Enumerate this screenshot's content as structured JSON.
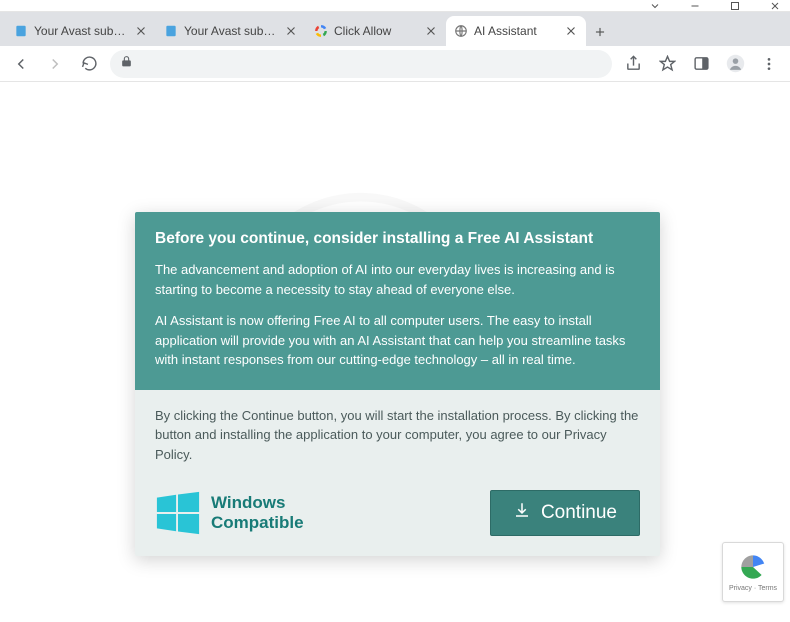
{
  "window": {
    "controls": {
      "min": "—",
      "max": "▢",
      "close": "✕"
    }
  },
  "tabs": [
    {
      "title": "Your Avast subscription",
      "favicon": "doc-blue"
    },
    {
      "title": "Your Avast subscription",
      "favicon": "doc-blue"
    },
    {
      "title": "Click Allow",
      "favicon": "recaptcha"
    },
    {
      "title": "AI Assistant",
      "favicon": "globe",
      "active": true
    }
  ],
  "toolbar": {
    "back": "back-icon",
    "forward": "forward-icon",
    "reload": "reload-icon",
    "lock": "lock-icon",
    "share": "share-icon",
    "star": "star-icon",
    "ext": "extension-icon",
    "profile": "profile-icon",
    "menu": "menu-icon",
    "address": ""
  },
  "modal": {
    "heading": "Before you continue, consider installing a Free AI Assistant",
    "p1": "The advancement and adoption of AI into our everyday lives is increasing and is starting to become a necessity to stay ahead of everyone else.",
    "p2": "AI Assistant is now offering Free AI to all computer users. The easy to install application will provide you with an AI Assistant that can help you streamline tasks with instant responses from our cutting-edge technology – all in real time.",
    "disclaimer": "By clicking the Continue button, you will start the installation process. By clicking the button and installing the application to your computer, you agree to our Privacy Policy.",
    "win_line1": "Windows",
    "win_line2": "Compatible",
    "continue_label": "Continue"
  },
  "recaptcha": {
    "line1": "Privacy · Terms"
  }
}
